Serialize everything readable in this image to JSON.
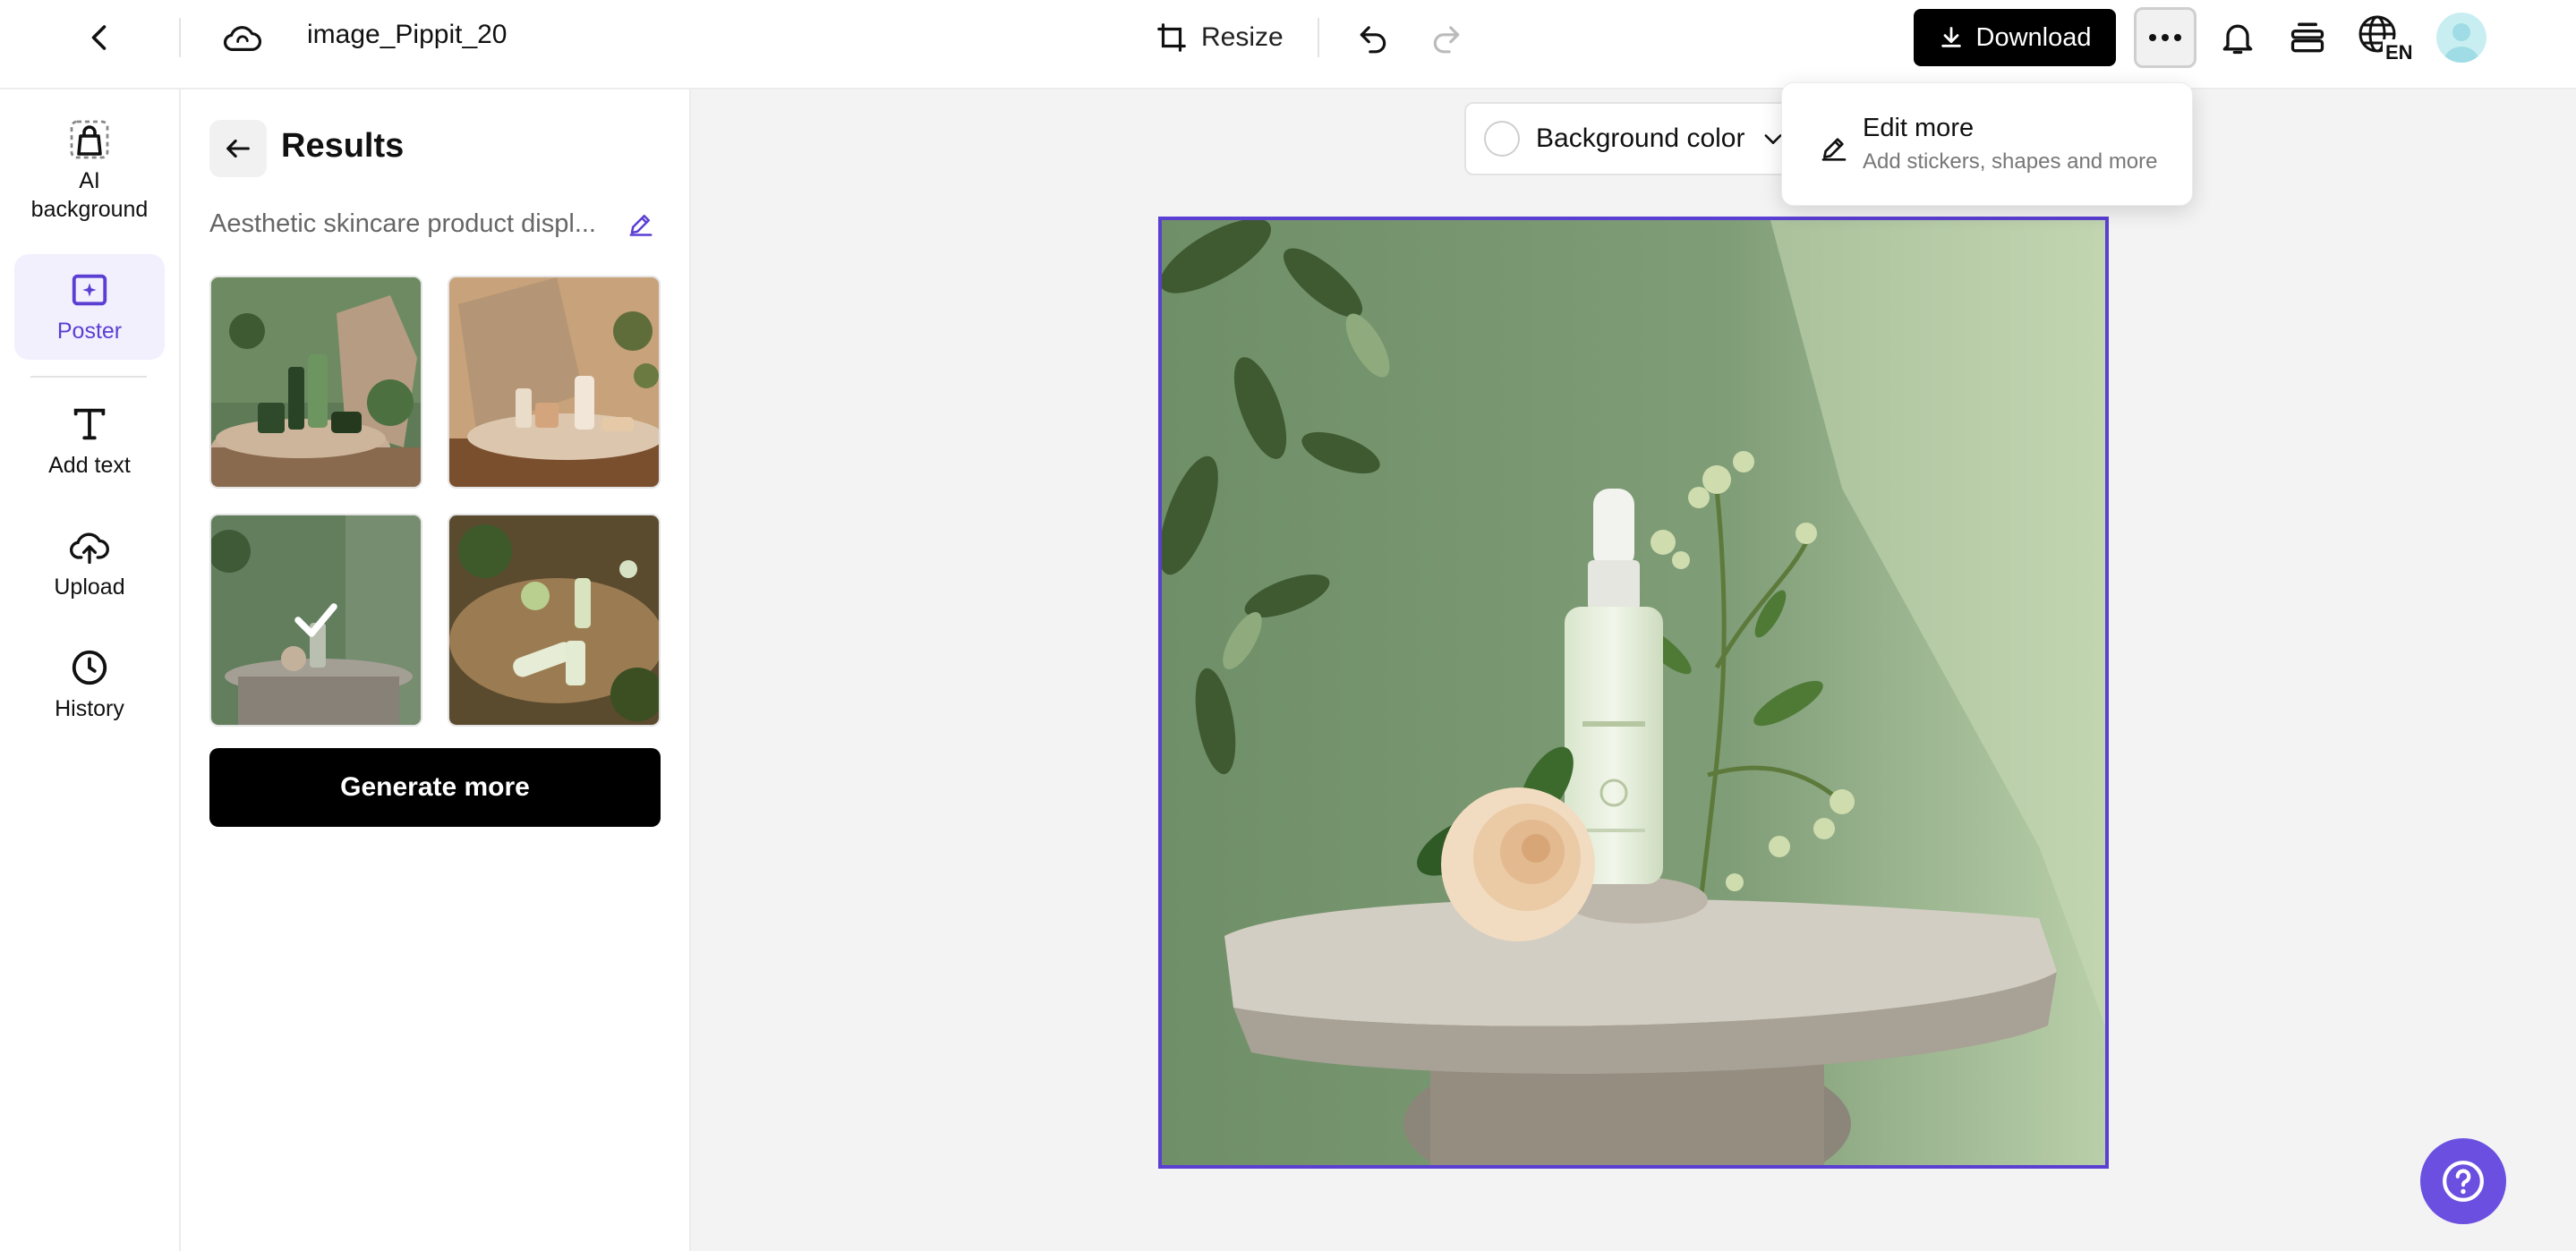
{
  "topbar": {
    "filename": "image_Pippit_20",
    "resize_label": "Resize",
    "download_label": "Download",
    "language_badge": "EN"
  },
  "rail": {
    "items": [
      {
        "label_line1": "AI",
        "label_line2": "background",
        "icon": "ai-background-icon"
      },
      {
        "label": "Poster",
        "icon": "poster-icon",
        "active": true
      },
      {
        "label": "Add text",
        "icon": "text-icon"
      },
      {
        "label": "Upload",
        "icon": "upload-icon"
      },
      {
        "label": "History",
        "icon": "history-icon"
      }
    ]
  },
  "results": {
    "title": "Results",
    "prompt": "Aesthetic skincare product displ...",
    "thumbnails": [
      {
        "index": 1,
        "selected": false
      },
      {
        "index": 2,
        "selected": false
      },
      {
        "index": 3,
        "selected": true
      },
      {
        "index": 4,
        "selected": false
      }
    ],
    "generate_label": "Generate more"
  },
  "canvas": {
    "background_color_label": "Background color"
  },
  "dropdown": {
    "title": "Edit more",
    "subtitle": "Add stickers, shapes and more"
  },
  "colors": {
    "accent": "#5b3fd3",
    "help_button": "#6b4fe0",
    "primary_button": "#000000"
  }
}
